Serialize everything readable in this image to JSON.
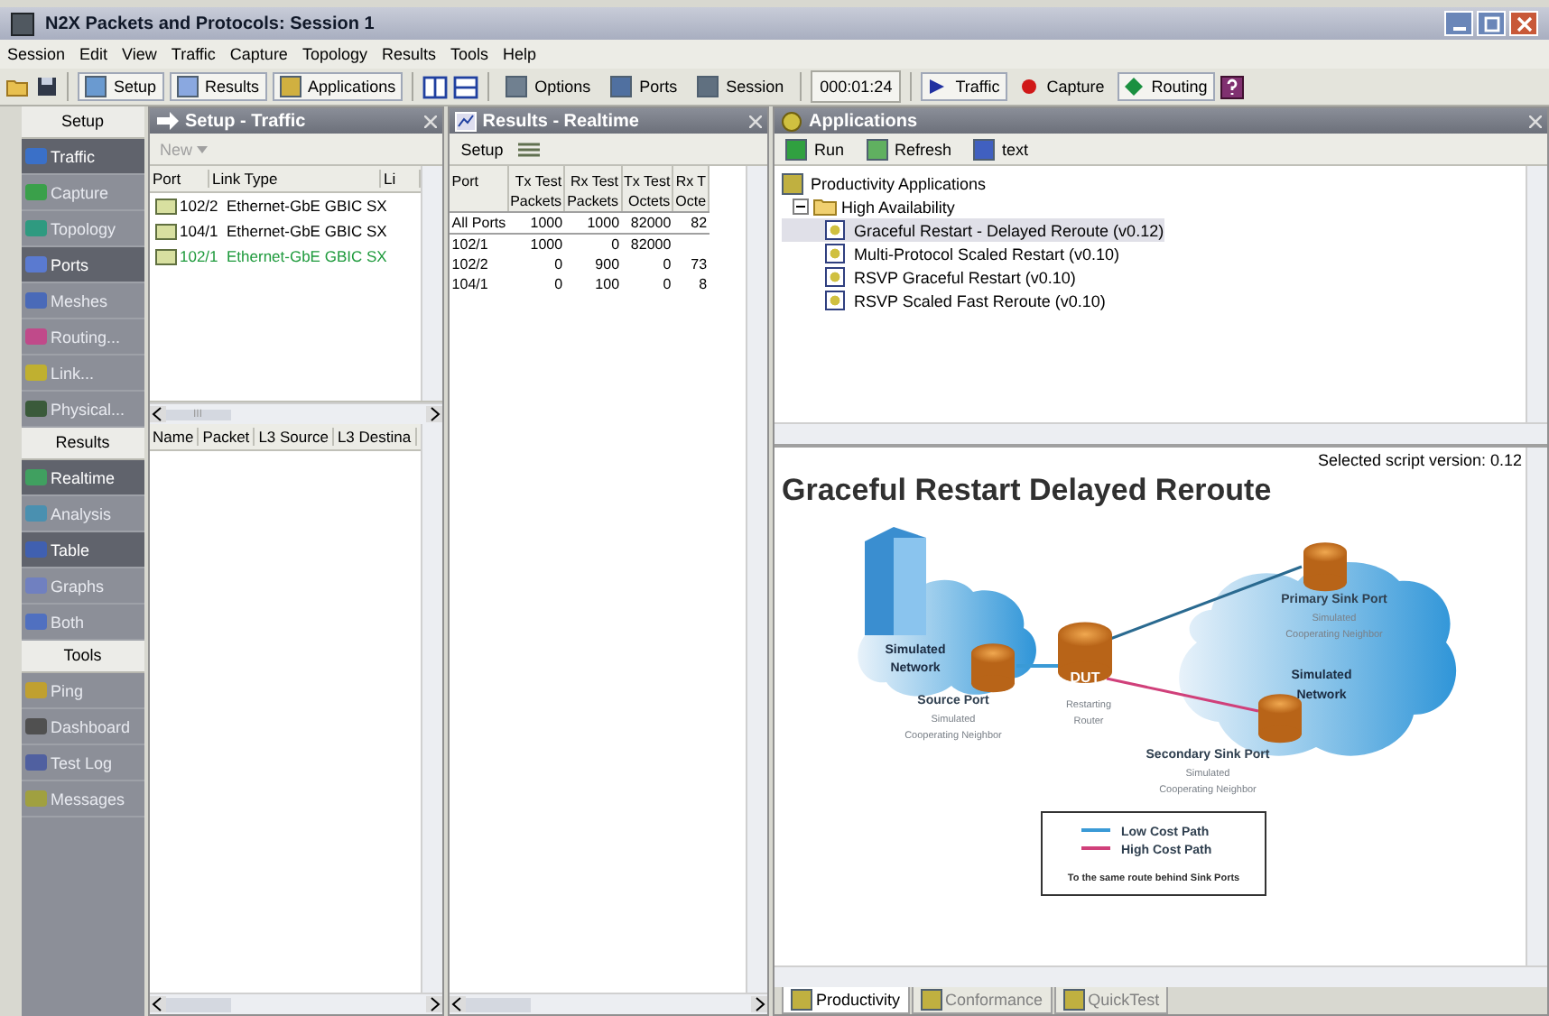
{
  "window": {
    "title": "N2X Packets and Protocols: Session 1"
  },
  "menu": [
    "Session",
    "Edit",
    "View",
    "Traffic",
    "Capture",
    "Topology",
    "Results",
    "Tools",
    "Help"
  ],
  "toolbar": {
    "views": [
      "Setup",
      "Results",
      "Applications"
    ],
    "tools": [
      "Options",
      "Ports",
      "Session"
    ],
    "timer": "000:01:24",
    "toggles": [
      {
        "label": "Traffic",
        "kind": "play",
        "on": true
      },
      {
        "label": "Capture",
        "kind": "record",
        "on": false
      },
      {
        "label": "Routing",
        "kind": "diamond",
        "on": true
      }
    ]
  },
  "sidebar": [
    {
      "heading": "Setup",
      "items": [
        {
          "label": "Traffic",
          "selected": true
        },
        {
          "label": "Capture",
          "selected": false
        },
        {
          "label": "Topology",
          "selected": false
        },
        {
          "label": "Ports",
          "selected": true
        },
        {
          "label": "Meshes",
          "selected": false
        },
        {
          "label": "Routing...",
          "selected": false
        },
        {
          "label": "Link...",
          "selected": false
        },
        {
          "label": "Physical...",
          "selected": false
        }
      ]
    },
    {
      "heading": "Results",
      "items": [
        {
          "label": "Realtime",
          "selected": true
        },
        {
          "label": "Analysis",
          "selected": false
        },
        {
          "label": "Table",
          "selected": true
        },
        {
          "label": "Graphs",
          "selected": false
        },
        {
          "label": "Both",
          "selected": false
        }
      ]
    },
    {
      "heading": "Tools",
      "items": [
        {
          "label": "Ping",
          "selected": false
        },
        {
          "label": "Dashboard",
          "selected": false
        },
        {
          "label": "Test Log",
          "selected": false
        },
        {
          "label": "Messages",
          "selected": false
        }
      ]
    }
  ],
  "setup_traffic": {
    "title": "Setup - Traffic",
    "new_button": "New",
    "columns": [
      "Port",
      "Link Type",
      "Li"
    ],
    "rows": [
      {
        "port": "102/2",
        "link_type": "Ethernet-GbE GBIC SX",
        "color": "#000000"
      },
      {
        "port": "104/1",
        "link_type": "Ethernet-GbE GBIC SX",
        "color": "#000000"
      },
      {
        "port": "102/1",
        "link_type": "Ethernet-GbE GBIC SX",
        "color": "#1e9a3c"
      }
    ],
    "scroll_label": "III",
    "capture_columns": [
      "Name",
      "Packet",
      "L3 Source",
      "L3 Destina"
    ]
  },
  "results_realtime": {
    "title": "Results - Realtime",
    "setup_button": "Setup",
    "header_rows": [
      [
        "Port",
        "Tx Test",
        "Rx Test",
        "Tx Test",
        "Rx T"
      ],
      [
        "Packets",
        "Packets",
        "Octets",
        "Octe"
      ]
    ],
    "rows": [
      [
        "All Ports",
        "1000",
        "1000",
        "82000",
        "82"
      ],
      [
        "102/1",
        "1000",
        "0",
        "82000",
        ""
      ],
      [
        "102/2",
        "0",
        "900",
        "0",
        "73"
      ],
      [
        "104/1",
        "0",
        "100",
        "0",
        "8"
      ]
    ]
  },
  "applications": {
    "title": "Applications",
    "toolbar": [
      "Run",
      "Refresh",
      "text"
    ],
    "tree": {
      "label": "Productivity Applications",
      "children": [
        {
          "label": "High Availability",
          "expanded": true,
          "children": [
            {
              "label": "Graceful Restart - Delayed Reroute  (v0.12)",
              "selected": true
            },
            {
              "label": "Multi-Protocol Scaled Restart  (v0.10)",
              "selected": false
            },
            {
              "label": "RSVP Graceful Restart  (v0.10)",
              "selected": false
            },
            {
              "label": "RSVP Scaled Fast Reroute  (v0.10)",
              "selected": false
            }
          ]
        }
      ]
    },
    "version": "Selected script version: 0.12",
    "heading": "Graceful Restart Delayed Reroute",
    "diagram": {
      "left_network": [
        "Simulated",
        "Network"
      ],
      "right_network": [
        "Simulated",
        "Network"
      ],
      "source": {
        "name": "Source Port",
        "note": [
          "Simulated",
          "Cooperating Neighbor"
        ]
      },
      "dut": {
        "name": "DUT",
        "note": [
          "Restarting",
          "Router"
        ]
      },
      "primary": {
        "name": "Primary Sink Port",
        "note": [
          "Simulated",
          "Cooperating Neighbor"
        ]
      },
      "secondary": {
        "name": "Secondary Sink Port",
        "note": [
          "Simulated",
          "Cooperating Neighbor"
        ]
      },
      "legend": [
        {
          "label": "Low Cost Path",
          "color": "#3a9ad6"
        },
        {
          "label": "High Cost Path",
          "color": "#d0407a"
        }
      ],
      "legend_note": "To the same route behind Sink Ports"
    },
    "tabs": [
      {
        "label": "Productivity",
        "selected": true
      },
      {
        "label": "Conformance",
        "selected": false
      },
      {
        "label": "QuickTest",
        "selected": false
      }
    ]
  }
}
